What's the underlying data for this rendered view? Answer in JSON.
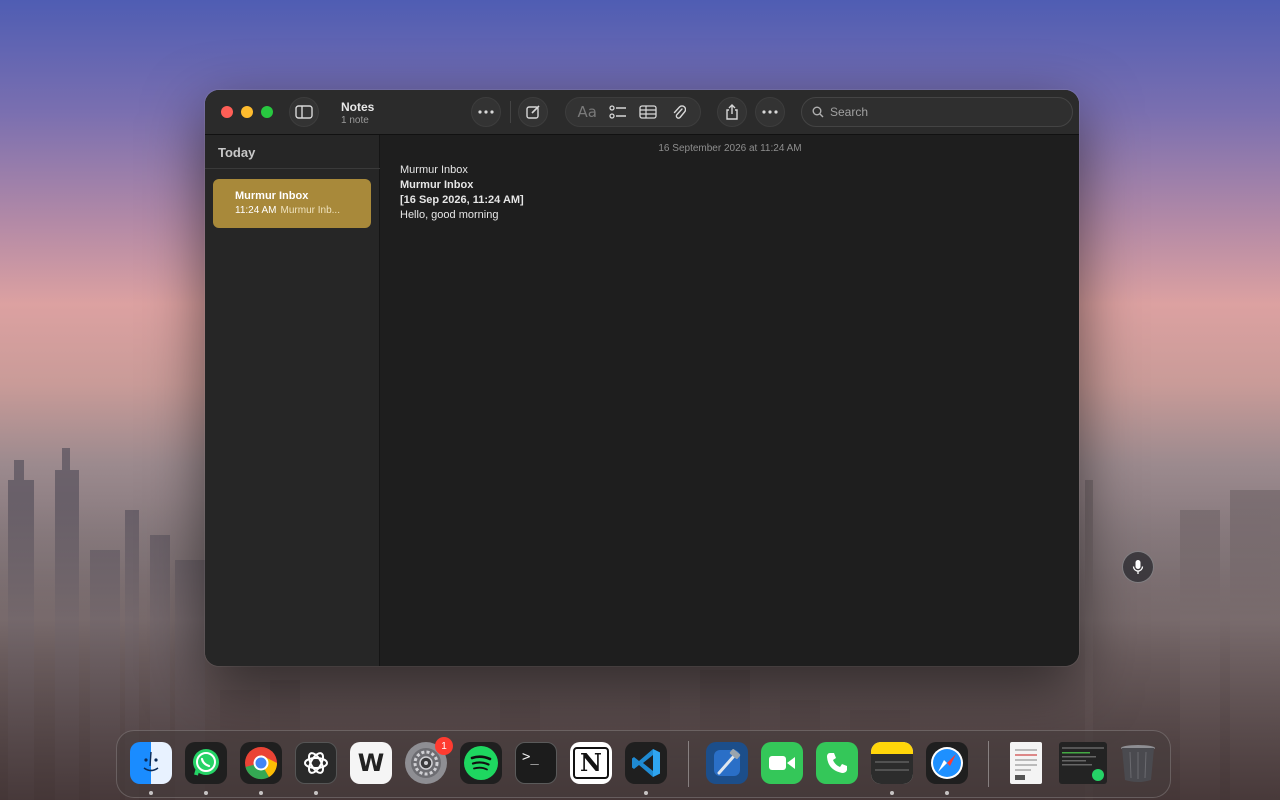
{
  "window": {
    "app_title": "Notes",
    "note_count": "1 note",
    "search_placeholder": "Search",
    "format_label": "Aa"
  },
  "sidebar": {
    "heading": "Today",
    "notes": [
      {
        "title": "Murmur Inbox",
        "time": "11:24 AM",
        "preview": "Murmur Inb..."
      }
    ]
  },
  "editor": {
    "date": "16 September 2026 at 11:24 AM",
    "lines": [
      {
        "text": "Murmur Inbox",
        "bold": false
      },
      {
        "text": "Murmur Inbox",
        "bold": true
      },
      {
        "text": "[16 Sep 2026, 11:24 AM]",
        "bold": true
      },
      {
        "text": "Hello, good morning",
        "bold": false
      }
    ]
  },
  "dock": {
    "apps": [
      "finder-icon",
      "whatsapp-icon",
      "chrome-icon",
      "chatgpt-icon",
      "wps-icon",
      "system-settings-icon",
      "spotify-icon",
      "terminal-icon",
      "notion-icon",
      "vscode-icon",
      "xcode-icon",
      "facetime-icon",
      "phone-icon",
      "notes-icon",
      "safari-icon"
    ],
    "settings_badge": "1",
    "terminal_prompt": ">_",
    "notion_letter": "N",
    "wps_letter": "W"
  },
  "colors": {
    "note_highlight": "#a8893a",
    "window_bg": "#1e1e1e"
  }
}
